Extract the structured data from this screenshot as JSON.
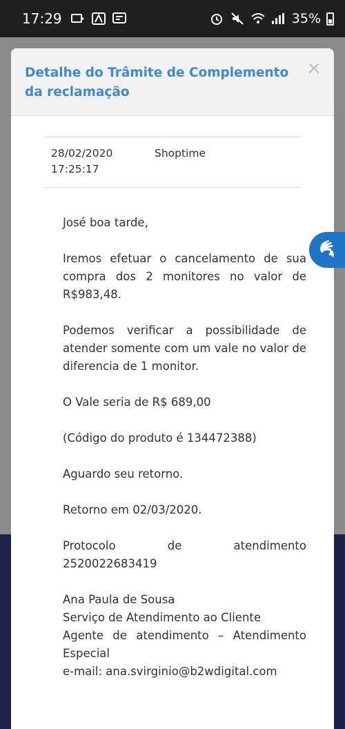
{
  "status_bar": {
    "time": "17:29",
    "battery": "35%"
  },
  "modal": {
    "title": "Detalhe do Trâmite de Complemento da reclamação",
    "close_label": "×",
    "meta": {
      "date": "28/02/2020",
      "time": "17:25:17",
      "company": "Shoptime"
    },
    "message": {
      "greeting": "José boa tarde,",
      "p1": "Iremos efetuar o cancelamento de sua compra dos 2 monitores no valor de R$983,48.",
      "p2": "Podemos verificar a possibilidade de atender somente com um vale no valor de diferencia de 1 monitor.",
      "p3": "O Vale seria de R$ 689,00",
      "p4": "(Código do produto é 134472388)",
      "p5": "Aguardo seu retorno.",
      "p6": "Retorno em 02/03/2020.",
      "p7": "Protocolo de atendimento 2520022683419",
      "sig_name": "Ana Paula de Sousa",
      "sig_dept": "Serviço de Atendimento ao Cliente",
      "sig_role": "Agente de atendimento – Atendimento Especial",
      "sig_email": "e-mail: ana.svirginio@b2wdigital.com"
    }
  },
  "colors": {
    "title": "#3e8ad2",
    "accessibility_button": "#1e74c7",
    "footer_bg": "#1d2145"
  },
  "icons": [
    "sim-icon",
    "a-icon",
    "sms-icon",
    "alarm-icon",
    "mute-icon",
    "wifi-icon",
    "signal-icon",
    "battery-icon",
    "close-icon",
    "sign-language-icon"
  ]
}
